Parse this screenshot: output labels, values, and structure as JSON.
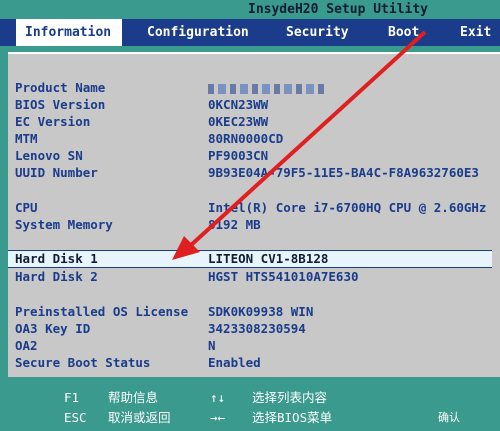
{
  "title": "InsydeH20 Setup Utility",
  "tabs": [
    {
      "label": "Information"
    },
    {
      "label": "Configuration"
    },
    {
      "label": "Security"
    },
    {
      "label": "Boot"
    },
    {
      "label": "Exit"
    }
  ],
  "rows": [
    {
      "label": "Product Name",
      "value": ""
    },
    {
      "label": "BIOS Version",
      "value": "0KCN23WW"
    },
    {
      "label": "EC Version",
      "value": "0KEC23WW"
    },
    {
      "label": "MTM",
      "value": "80RN0000CD"
    },
    {
      "label": "Lenovo SN",
      "value": "PF9003CN"
    },
    {
      "label": "UUID Number",
      "value": "9B93E04A-79F5-11E5-BA4C-F8A9632760E3"
    },
    {
      "label": "CPU",
      "value": "Intel(R) Core i7-6700HQ CPU @ 2.60GHz"
    },
    {
      "label": "System Memory",
      "value": "8192 MB"
    },
    {
      "label": "Hard Disk 1",
      "value": "LITEON CV1-8B128"
    },
    {
      "label": "Hard Disk 2",
      "value": "HGST HTS541010A7E630"
    },
    {
      "label": "Preinstalled OS License",
      "value": "SDK0K09938 WIN"
    },
    {
      "label": "OA3 Key ID",
      "value": "3423308230594"
    },
    {
      "label": "OA2",
      "value": "N"
    },
    {
      "label": "Secure Boot Status",
      "value": "Enabled"
    }
  ],
  "footer": {
    "f1_key": "F1",
    "f1_desc": "帮助信息",
    "esc_key": "ESC",
    "esc_desc": "取消或返回",
    "updown_key": "↑↓",
    "updown_desc": "选择列表内容",
    "leftright_key": "→←",
    "leftright_desc": "选择BIOS菜单",
    "enter_label": "确认"
  },
  "colors": {
    "accent": "#1a3c8a",
    "footer": "#3a9a8e",
    "panel": "#c8c8c8",
    "arrow": "#e02020"
  }
}
